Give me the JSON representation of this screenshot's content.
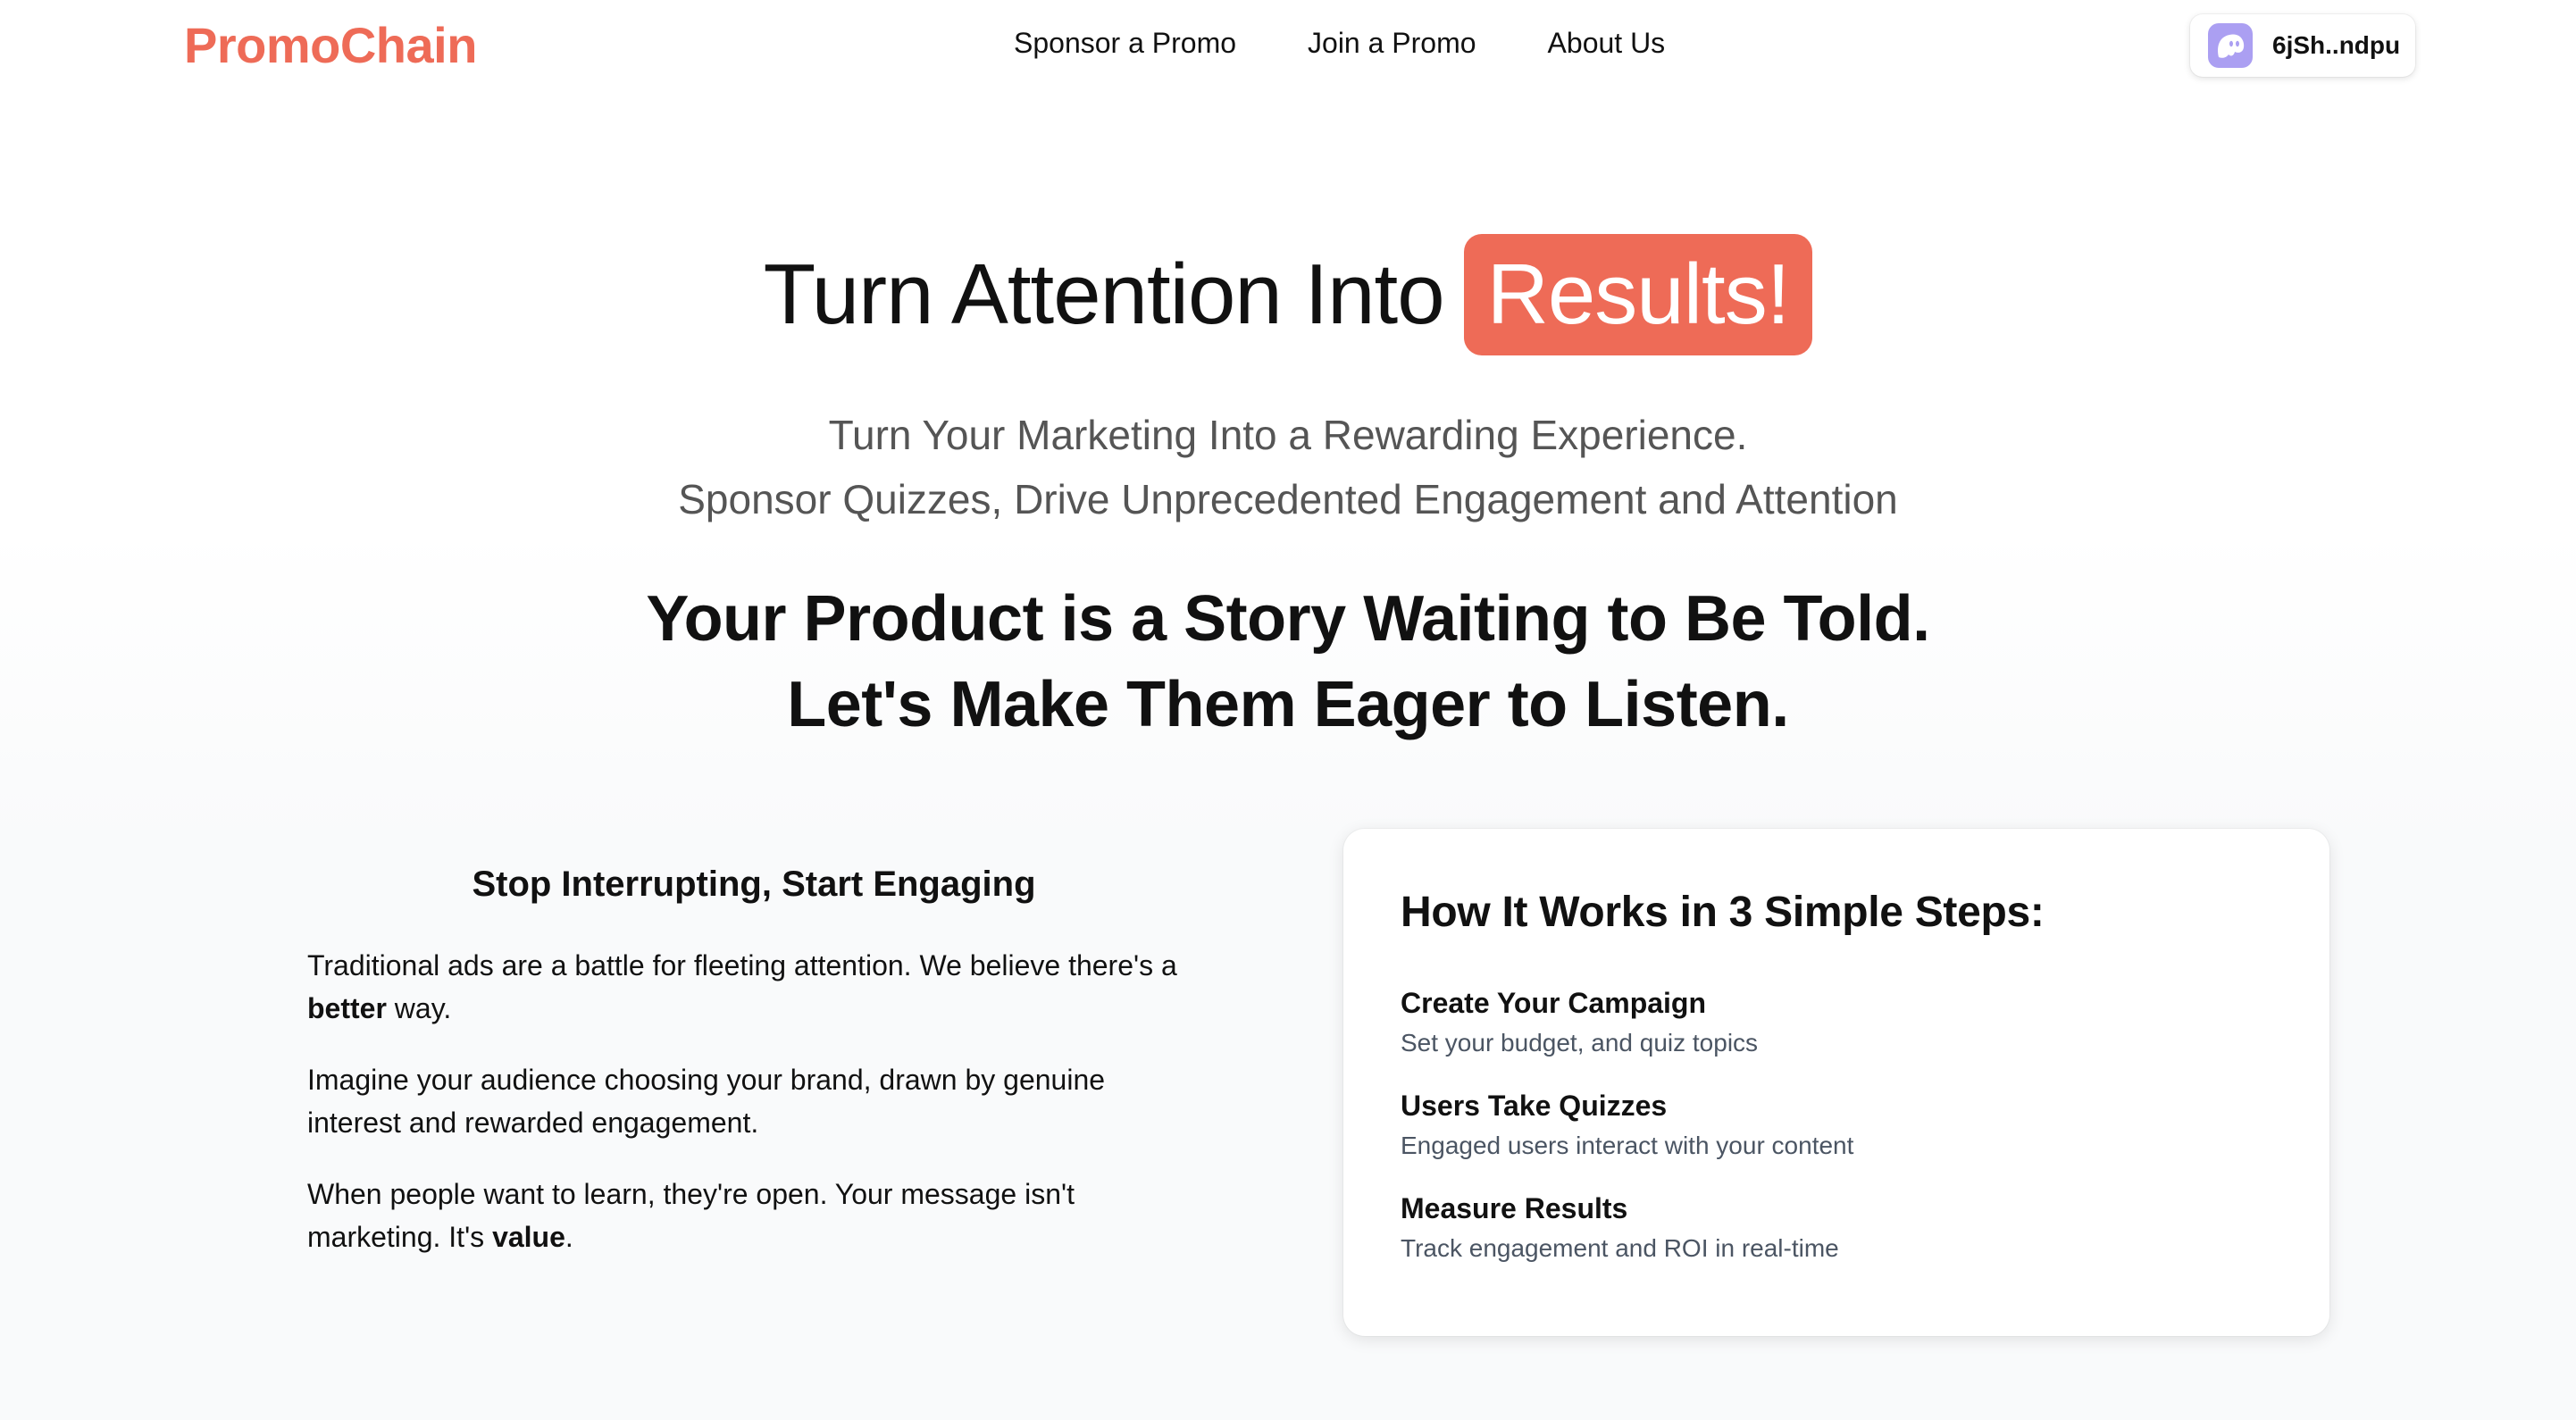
{
  "nav": {
    "brand": "PromoChain",
    "links": [
      "Sponsor a Promo",
      "Join a Promo",
      "About Us"
    ],
    "wallet": {
      "address": "6jSh..ndpu",
      "icon": "ghost-wallet-icon"
    }
  },
  "hero": {
    "title_prefix": "Turn Attention Into",
    "title_highlight": "Results!",
    "subtitle_line1": "Turn Your Marketing Into a Rewarding Experience.",
    "subtitle_line2": "Sponsor Quizzes, Drive Unprecedented Engagement and Attention"
  },
  "tagline": {
    "line1": "Your Product is a Story Waiting to Be Told.",
    "line2": "Let's Make Them Eager to Listen."
  },
  "engage": {
    "heading": "Stop Interrupting, Start Engaging",
    "p1_text": "Traditional ads are a battle for fleeting attention. We believe there's a",
    "p1_bold": "better",
    "p1_end": "way.",
    "p2": "Imagine your audience choosing your brand, drawn by genuine interest and rewarded engagement.",
    "p3_text": "When people want to learn, they're open. Your message isn't marketing. It's",
    "p3_bold": "value",
    "p3_end": "."
  },
  "steps": {
    "title": "How It Works in 3 Simple Steps:",
    "items": [
      {
        "title": "Create Your Campaign",
        "desc": "Set your budget, and quiz topics"
      },
      {
        "title": "Users Take Quizzes",
        "desc": "Engaged users interact with your content"
      },
      {
        "title": "Measure Results",
        "desc": "Track engagement and ROI in real-time"
      }
    ]
  },
  "colors": {
    "accent": "#ee6b57",
    "wallet_icon_bg": "#ab9ff2",
    "muted_text": "#555555",
    "step_desc": "#4b5563"
  }
}
